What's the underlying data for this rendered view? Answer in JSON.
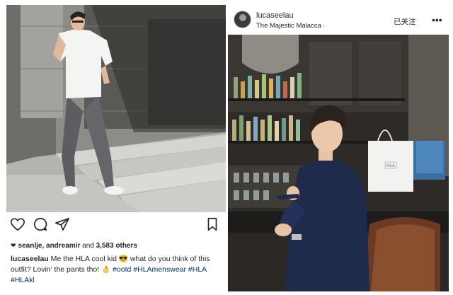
{
  "left_post": {
    "photo_alt": "man-in-white-shirt-on-steps",
    "actions": {
      "like_icon": "heart-outline-icon",
      "comment_icon": "comment-icon",
      "share_icon": "paper-plane-icon",
      "save_icon": "bookmark-icon"
    },
    "likes": {
      "heart_glyph": "❤",
      "users": "seanlje, andreamir",
      "and_text": "and",
      "count_text": "3,583 others"
    },
    "caption": {
      "username": "lucaseelau",
      "text_part1": " Me the HLA cool kid ",
      "emoji1": "😎",
      "text_part2": " what do you think of this outfit? Lovin' the pants tho! ",
      "emoji2": "👌",
      "tag1": "#ootd",
      "tag2": "#HLAmenswear",
      "tag3": "#HLA",
      "tag4": "#HLAkl"
    }
  },
  "right_post": {
    "header": {
      "username": "lucaseelau",
      "location": "The Majestic Malacca",
      "location_chevron": "›",
      "follow_status": "已关注",
      "more": "•••"
    },
    "photo": {
      "bag_brand": "HLA"
    }
  },
  "colors": {
    "text": "#262626",
    "hashtag": "#003569",
    "divider": "#dbdbdb"
  }
}
